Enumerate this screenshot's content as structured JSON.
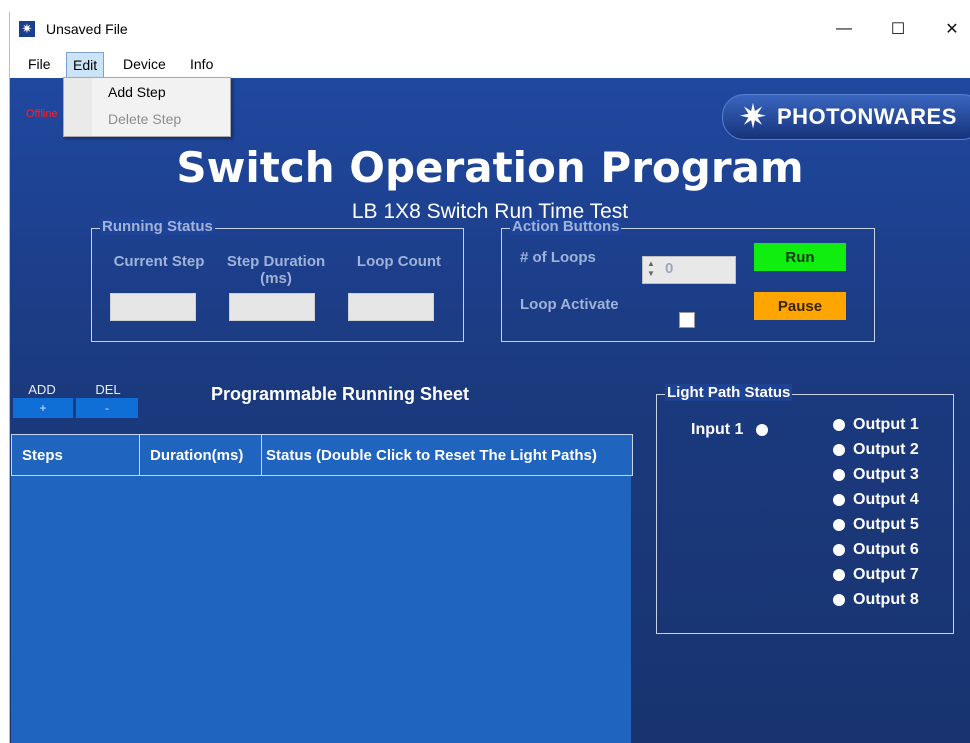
{
  "window": {
    "title": "Unsaved File",
    "icon": "photonwares-star-icon"
  },
  "window_controls": {
    "minimize": "—",
    "maximize": "☐",
    "close": "✕"
  },
  "menu": {
    "items": [
      "File",
      "Edit",
      "Device",
      "Info"
    ],
    "open": "Edit"
  },
  "edit_menu": {
    "items": [
      {
        "label": "Add Step",
        "enabled": true
      },
      {
        "label": "Delete Step",
        "enabled": false
      }
    ]
  },
  "status": {
    "offline_label": "Offline"
  },
  "logo": {
    "text": "PHOTONWARES"
  },
  "header": {
    "title": "Switch Operation Program",
    "subtitle": "LB 1X8 Switch Run Time Test"
  },
  "running_status": {
    "legend": "Running Status",
    "labels": {
      "current_step": "Current Step",
      "step_duration": "Step Duration (ms)",
      "loop_count": "Loop Count"
    },
    "values": {
      "current_step": "",
      "step_duration": "",
      "loop_count": ""
    }
  },
  "action_buttons": {
    "legend": "Action Buttons",
    "loops_label": "# of Loops",
    "loops_value": "0",
    "loop_activate_label": "Loop Activate",
    "loop_activate_checked": false,
    "run_label": "Run",
    "pause_label": "Pause",
    "colors": {
      "run": "#10ee10",
      "pause": "#ffa500"
    }
  },
  "sheet_controls": {
    "add_label": "ADD",
    "add_symbol": "+",
    "del_label": "DEL",
    "del_symbol": "-"
  },
  "running_sheet": {
    "title": "Programmable Running Sheet",
    "columns": [
      "Steps",
      "Duration(ms)",
      "Status (Double Click to Reset The Light Paths)"
    ],
    "rows": []
  },
  "light_path": {
    "legend": "Light Path Status",
    "input": "Input 1",
    "outputs": [
      "Output 1",
      "Output 2",
      "Output 3",
      "Output 4",
      "Output 5",
      "Output 6",
      "Output 7",
      "Output 8"
    ]
  }
}
